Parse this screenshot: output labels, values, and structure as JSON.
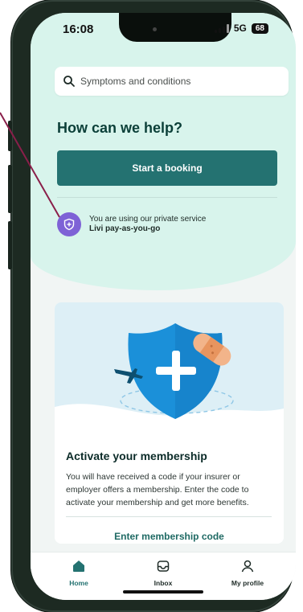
{
  "status": {
    "time": "16:08",
    "network": "5G",
    "battery": "68"
  },
  "search": {
    "placeholder": "Symptoms and conditions"
  },
  "hero": {
    "heading": "How can we help?",
    "booking_button": "Start a booking",
    "private_line1": "You are using our private service",
    "private_line2": "Livi pay-as-you-go"
  },
  "membership": {
    "title": "Activate your membership",
    "body": "You will have received a code if your insurer or employer offers a membership. Enter the code to activate your membership and get more benefits.",
    "cta": "Enter membership code"
  },
  "tabs": [
    {
      "label": "Home",
      "icon": "home-icon"
    },
    {
      "label": "Inbox",
      "icon": "inbox-icon"
    },
    {
      "label": "My profile",
      "icon": "profile-icon"
    }
  ],
  "colors": {
    "accent": "#247271",
    "hero_bg": "#d8f4ec",
    "badge": "#7e62d6",
    "annotation_line": "#8a1f4a"
  }
}
